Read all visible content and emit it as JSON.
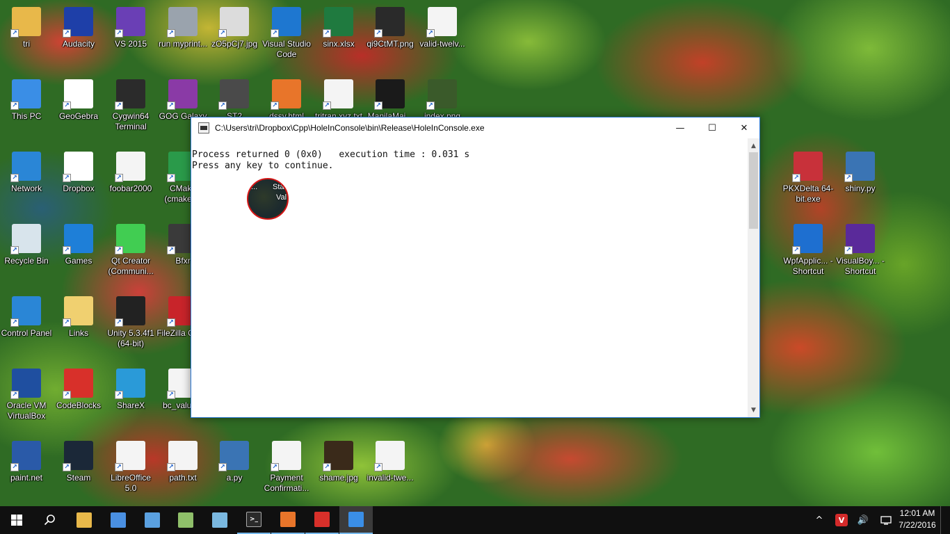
{
  "desktop": {
    "icons": [
      {
        "label": "tri",
        "icon": "user-folder-icon",
        "color": "#e8b84a"
      },
      {
        "label": "Audacity",
        "icon": "audacity-icon",
        "color": "#1e3fa8"
      },
      {
        "label": "VS 2015",
        "icon": "visual-studio-icon",
        "color": "#6a3fb5"
      },
      {
        "label": "run myprint...",
        "icon": "gear-script-icon",
        "color": "#9aa3ad"
      },
      {
        "label": "zO5pCj7.jpg",
        "icon": "image-file-icon",
        "color": "#dcdcdc"
      },
      {
        "label": "Visual Studio Code",
        "icon": "vscode-icon",
        "color": "#1e77d0"
      },
      {
        "label": "sinx.xlsx",
        "icon": "excel-icon",
        "color": "#1f7a3f"
      },
      {
        "label": "qi9CtMT.png",
        "icon": "image-file-icon",
        "color": "#2a2a2a"
      },
      {
        "label": "valid-twelv...",
        "icon": "text-file-icon",
        "color": "#f4f4f4"
      },
      {
        "label": "This PC",
        "icon": "computer-icon",
        "color": "#3a8ee6"
      },
      {
        "label": "GeoGebra",
        "icon": "geogebra-icon",
        "color": "#ffffff"
      },
      {
        "label": "Cygwin64 Terminal",
        "icon": "terminal-icon",
        "color": "#2b2b2b"
      },
      {
        "label": "GOG Galaxy",
        "icon": "gog-icon",
        "color": "#8a3aa6"
      },
      {
        "label": "ST2",
        "icon": "sublime-icon",
        "color": "#4a4a4a"
      },
      {
        "label": "dssv.html",
        "icon": "firefox-doc-icon",
        "color": "#e8752a"
      },
      {
        "label": "tritran.xyz.txt",
        "icon": "text-file-icon",
        "color": "#f4f4f4"
      },
      {
        "label": "ManilaMai...",
        "icon": "ogg-file-icon",
        "color": "#1a1a1a"
      },
      {
        "label": "index.png",
        "icon": "image-file-icon",
        "color": "#3a5a2a"
      },
      {
        "label": "Network",
        "icon": "network-icon",
        "color": "#2a86d6"
      },
      {
        "label": "Dropbox",
        "icon": "dropbox-icon",
        "color": "#ffffff"
      },
      {
        "label": "foobar2000",
        "icon": "foobar-icon",
        "color": "#f4f4f4"
      },
      {
        "label": "CMake (cmake-...",
        "icon": "cmake-icon",
        "color": "#2a9a4a"
      },
      {
        "label": "PKXDelta 64-bit.exe",
        "icon": "pokeball-icon",
        "color": "#c8313a"
      },
      {
        "label": "shiny.py",
        "icon": "python-file-icon",
        "color": "#3a74b4"
      },
      {
        "label": "Recycle Bin",
        "icon": "recycle-bin-icon",
        "color": "#d8e4ec"
      },
      {
        "label": "Games",
        "icon": "games-folder-icon",
        "color": "#1e7fd8"
      },
      {
        "label": "Qt Creator (Communi...",
        "icon": "qt-icon",
        "color": "#41cd52"
      },
      {
        "label": "Bfxr",
        "icon": "bfxr-icon",
        "color": "#3a3a3a"
      },
      {
        "label": "WpfApplic... - Shortcut",
        "icon": "wpf-app-icon",
        "color": "#1e6fd0"
      },
      {
        "label": "VisualBoy... - Shortcut",
        "icon": "gba-icon",
        "color": "#5a2a9a"
      },
      {
        "label": "Control Panel",
        "icon": "control-panel-icon",
        "color": "#2a86d6"
      },
      {
        "label": "Links",
        "icon": "links-folder-icon",
        "color": "#f0d070"
      },
      {
        "label": "Unity 5.3.4f1 (64-bit)",
        "icon": "unity-icon",
        "color": "#222222"
      },
      {
        "label": "FileZilla Client",
        "icon": "filezilla-icon",
        "color": "#c8242a"
      },
      {
        "label": "Oracle VM VirtualBox",
        "icon": "virtualbox-icon",
        "color": "#1f4fa0"
      },
      {
        "label": "CodeBlocks",
        "icon": "codeblocks-icon",
        "color": "#d8302a"
      },
      {
        "label": "ShareX",
        "icon": "sharex-icon",
        "color": "#2a9ad8"
      },
      {
        "label": "bc_value...",
        "icon": "image-file-icon",
        "color": "#f4f4f4"
      },
      {
        "label": "paint.net",
        "icon": "paint-net-icon",
        "color": "#2a5aa8"
      },
      {
        "label": "Steam",
        "icon": "steam-icon",
        "color": "#1b2838"
      },
      {
        "label": "LibreOffice 5.0",
        "icon": "libreoffice-icon",
        "color": "#f4f4f4"
      },
      {
        "label": "path.txt",
        "icon": "text-file-icon",
        "color": "#f4f4f4"
      },
      {
        "label": "a.py",
        "icon": "python-file-icon",
        "color": "#3a74b4"
      },
      {
        "label": "Payment Confirmati...",
        "icon": "document-file-icon",
        "color": "#f4f4f4"
      },
      {
        "label": "shame.jpg",
        "icon": "image-file-icon",
        "color": "#3a2a1a"
      },
      {
        "label": "invalid-twe...",
        "icon": "text-file-icon",
        "color": "#f4f4f4"
      }
    ]
  },
  "console_window": {
    "title": "C:\\Users\\tri\\Dropbox\\Cpp\\HoleInConsole\\bin\\Release\\HoleInConsole.exe",
    "lines": [
      "Process returned 0 (0x0)   execution time : 0.031 s",
      "Press any key to continue."
    ],
    "hole_text": [
      "...",
      "Sta",
      "Val"
    ],
    "minimize_glyph": "—",
    "maximize_glyph": "☐",
    "close_glyph": "✕"
  },
  "taskbar": {
    "buttons": [
      {
        "name": "start-button",
        "icon": "windows-logo-icon",
        "color": "#ffffff"
      },
      {
        "name": "search-button",
        "icon": "search-icon",
        "color": "#ffffff"
      },
      {
        "name": "file-explorer-button",
        "icon": "folder-icon",
        "color": "#e8b84a"
      },
      {
        "name": "taskbar-app-2",
        "icon": "satellite-icon",
        "color": "#4a90e2"
      },
      {
        "name": "taskbar-paint-button",
        "icon": "palette-icon",
        "color": "#5aa0e0"
      },
      {
        "name": "taskbar-notepad-button",
        "icon": "notepad-icon",
        "color": "#8fbf6a"
      },
      {
        "name": "taskbar-app-6",
        "icon": "crystal-icon",
        "color": "#7ab8e0"
      },
      {
        "name": "taskbar-cmd-button",
        "icon": "cmd-icon",
        "color": "#2a2a2a"
      },
      {
        "name": "taskbar-firefox-button",
        "icon": "firefox-icon",
        "color": "#e8752a"
      },
      {
        "name": "taskbar-codeblocks-button",
        "icon": "codeblocks-icon",
        "color": "#d8302a"
      },
      {
        "name": "taskbar-console-button",
        "icon": "console-app-icon",
        "color": "#3a8ee6"
      }
    ],
    "tray": {
      "chevron": "^",
      "vivaldi": "V",
      "volume": "🔊",
      "notifications": "☰"
    },
    "clock": {
      "time": "12:01 AM",
      "date": "7/22/2016"
    }
  }
}
